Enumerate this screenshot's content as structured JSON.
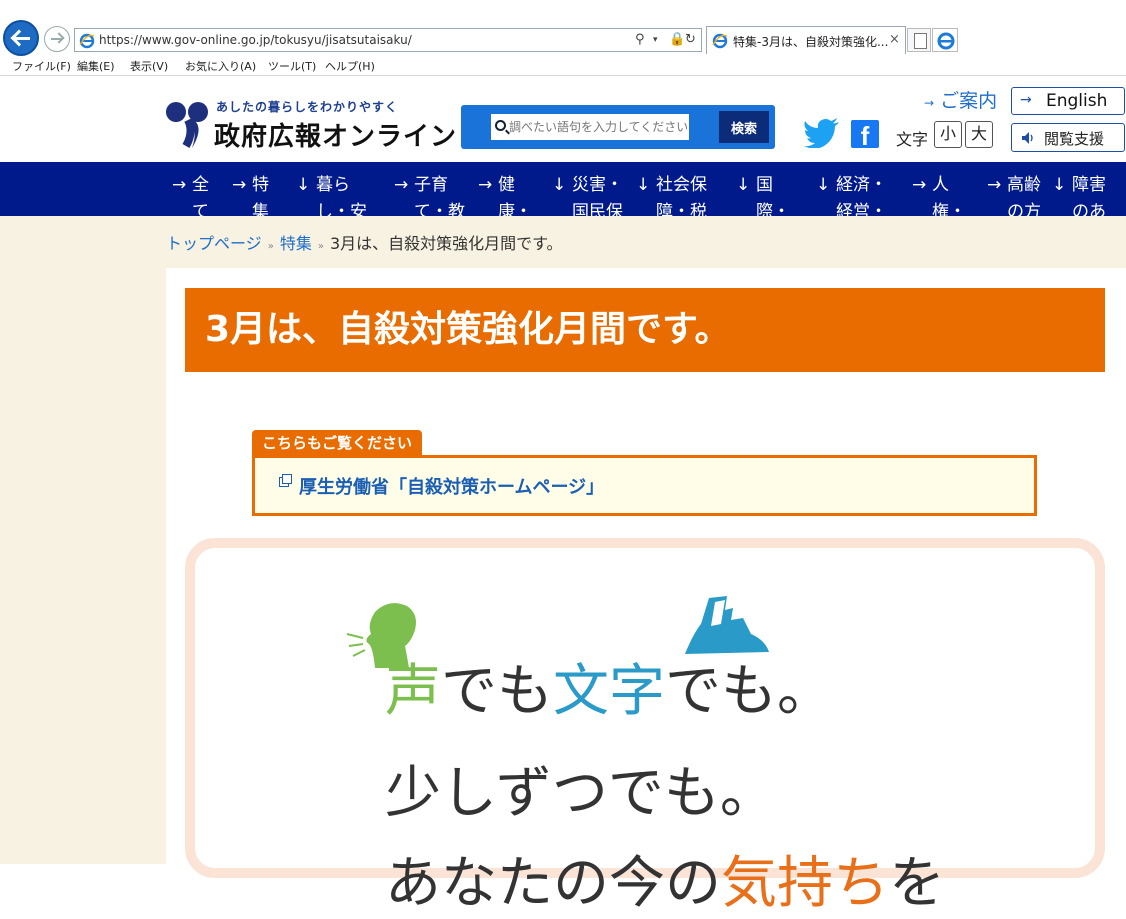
{
  "browser": {
    "url": "https://www.gov-online.go.jp/tokusyu/jisatsutaisaku/",
    "tab_title": "特集-3月は、自殺対策強化...",
    "tab_close": "×",
    "menu": [
      "ファイル(F)",
      "編集(E)",
      "表示(V)",
      "お気に入り(A)",
      "ツール(T)",
      "ヘルプ(H)"
    ]
  },
  "header": {
    "tagline": "あしたの暮らしをわかりやすく",
    "site_title": "政府広報オンライン",
    "search_placeholder": "調べたい語句を入力してください",
    "search_button": "検索",
    "guide_link": "ご案内",
    "english_button": "English",
    "text_size_label": "文字",
    "size_small": "小",
    "size_large": "大",
    "reading_support": "閲覧支援",
    "arrow": "→"
  },
  "global_nav": [
    {
      "arrow": "→",
      "label": "全て"
    },
    {
      "arrow": "→",
      "label": "特集"
    },
    {
      "arrow": "↓",
      "label": "暮らし・安全"
    },
    {
      "arrow": "→",
      "label": "子育て・教育"
    },
    {
      "arrow": "→",
      "label": "健康・医療"
    },
    {
      "arrow": "↓",
      "label": "災害・国民保護"
    },
    {
      "arrow": "↓",
      "label": "社会保障・税"
    },
    {
      "arrow": "↓",
      "label": "国際・観光"
    },
    {
      "arrow": "↓",
      "label": "経済・経営・労働"
    },
    {
      "arrow": "→",
      "label": "人権・文化等"
    },
    {
      "arrow": "→",
      "label": "高齢の方"
    },
    {
      "arrow": "↓",
      "label": "障害のある方"
    }
  ],
  "breadcrumb": {
    "home": "トップページ",
    "section": "特集",
    "current": "3月は、自殺対策強化月間です。",
    "separator": "»"
  },
  "page": {
    "title": "3月は、自殺対策強化月間です。",
    "related_label": "こちらもご覧ください",
    "related_link": "厚生労働省「自殺対策ホームページ」"
  },
  "promo": {
    "line1_a": "声",
    "line1_b": "でも",
    "line1_c": "文字",
    "line1_d": "でも。",
    "line2": "少しずつでも。",
    "line3_a": "あなたの今の",
    "line3_b": "気持ち",
    "line3_c": "を"
  },
  "colors": {
    "nav_bg": "#001a8c",
    "title_bg": "#e86c00",
    "search_bg": "#1a73d8",
    "link": "#1f6ec9"
  }
}
